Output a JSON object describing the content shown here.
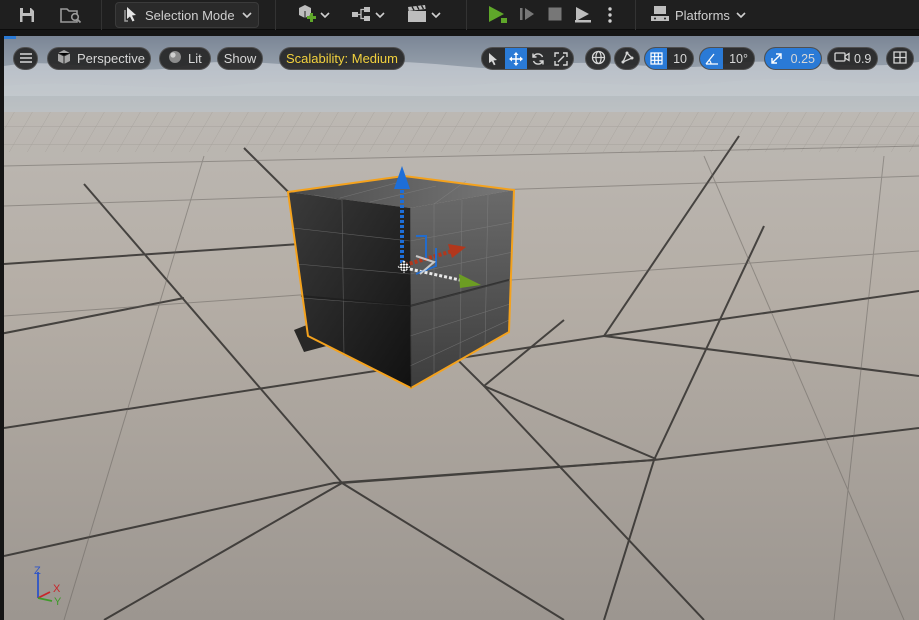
{
  "toolbar": {
    "selection_mode_label": "Selection Mode",
    "platforms_label": "Platforms",
    "icons": [
      "save-icon",
      "content-browser-icon",
      "selection-mode-icon",
      "add-actor-icon",
      "blueprint-icon",
      "cinematics-icon",
      "play-icon",
      "step-icon",
      "stop-icon",
      "eject-icon",
      "more-options-icon",
      "platforms-icon"
    ],
    "play_color": "#5fa72a"
  },
  "viewport": {
    "perspective_label": "Perspective",
    "lit_label": "Lit",
    "show_label": "Show",
    "scalability_label": "Scalability: Medium",
    "scalability_color": "#f2d13e",
    "grid_snap_value": "10",
    "rotation_snap_value": "10°",
    "scale_snap_value": "0.25",
    "camera_speed_value": "0.9",
    "accent_color": "#2a7ad6",
    "selection_outline_color": "#f4a21d",
    "axis_labels": {
      "x": "X",
      "y": "Y",
      "z": "Z"
    }
  }
}
